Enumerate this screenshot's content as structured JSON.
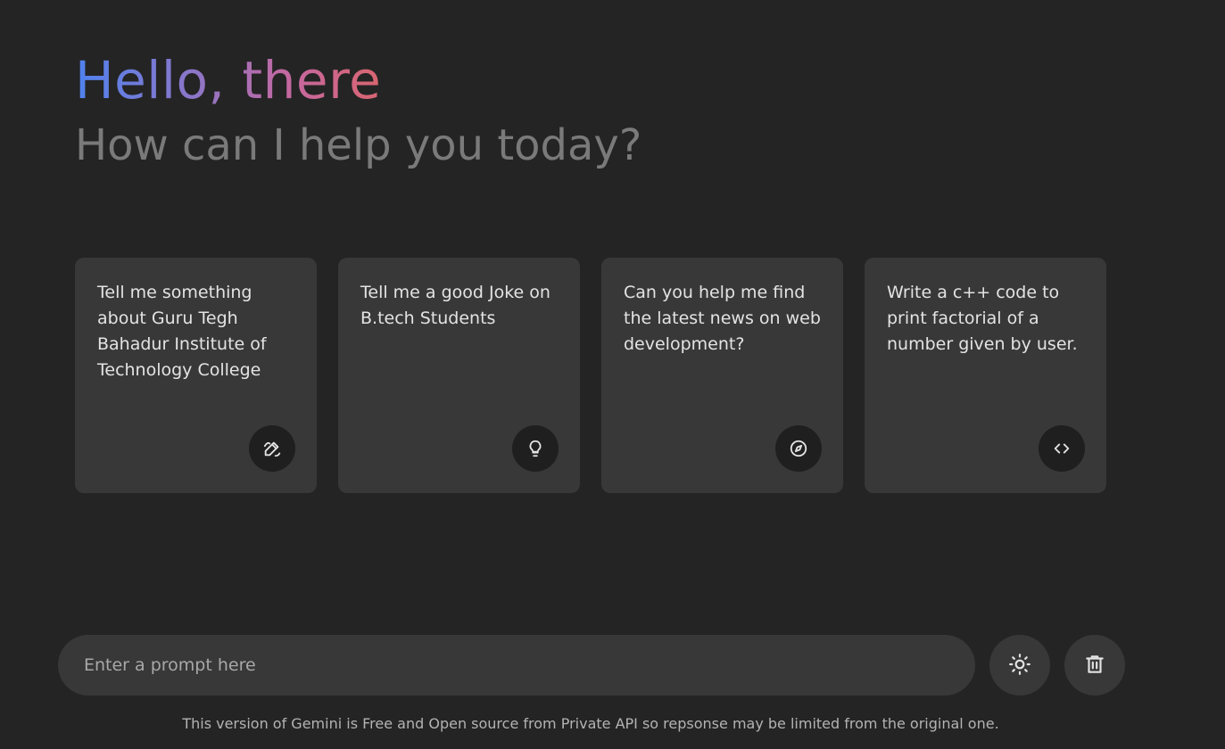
{
  "header": {
    "greeting": "Hello, there",
    "subtitle": "How can I help you today?"
  },
  "suggestions": [
    {
      "text": "Tell me something about Guru Tegh Bahadur Institute of Technology College",
      "icon": "draw-icon"
    },
    {
      "text": "Tell me a good Joke on B.tech Students",
      "icon": "lightbulb-icon"
    },
    {
      "text": "Can you help me find the latest news on web development?",
      "icon": "explore-icon"
    },
    {
      "text": "Write a c++ code to print factorial of a number given by user.",
      "icon": "code-icon"
    }
  ],
  "typing": {
    "placeholder": "Enter a prompt here",
    "value": ""
  },
  "disclaimer": "This version of Gemini is Free and Open source from Private API so repsonse may be limited from the original one.",
  "colors": {
    "background": "#242424",
    "card": "#383838",
    "icon_bg": "#1f1f1f",
    "gradient_start": "#4f82ee",
    "gradient_end": "#d96570",
    "subtitle": "#7a7a7a"
  }
}
